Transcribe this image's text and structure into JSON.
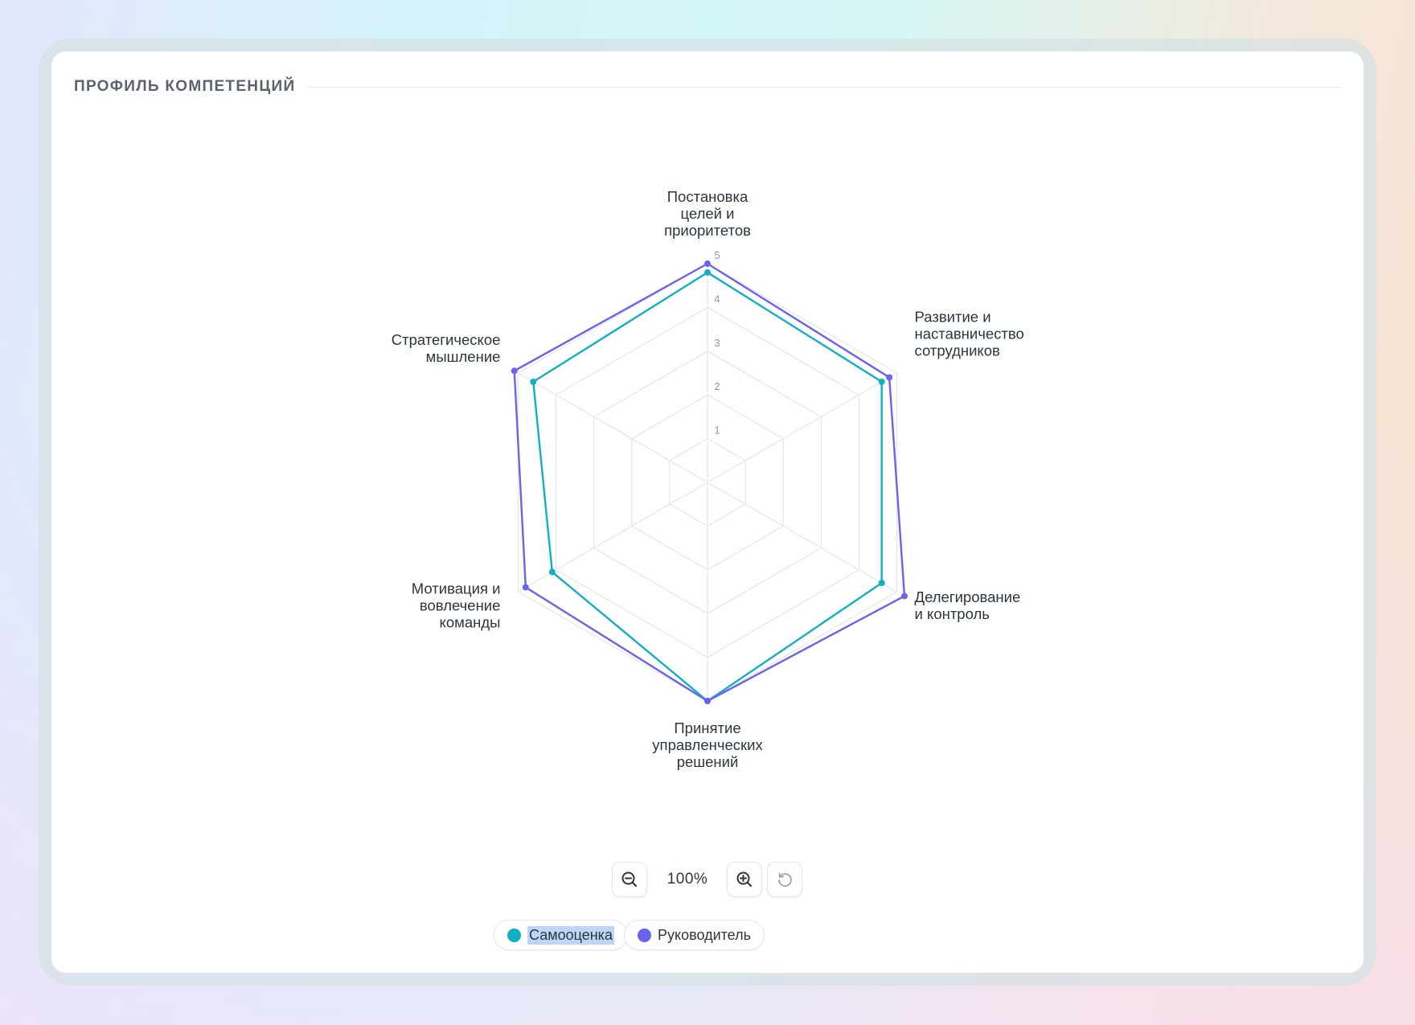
{
  "card": {
    "title": "ПРОФИЛЬ КОМПЕТЕНЦИЙ"
  },
  "chart_data": {
    "type": "radar",
    "axes": [
      [
        "Постановка",
        "целей и",
        "приоритетов"
      ],
      [
        "Развитие и",
        "наставничество",
        "сотрудников"
      ],
      [
        "Делегирование",
        "и контроль"
      ],
      [
        "Принятие",
        "управленческих",
        "решений"
      ],
      [
        "Мотивация и",
        "вовлечение",
        "команды"
      ],
      [
        "Стратегическое",
        "мышление"
      ]
    ],
    "range": [
      0,
      5
    ],
    "ticks": [
      1,
      2,
      3,
      4,
      5
    ],
    "grid": true,
    "legend_position": "bottom",
    "series": [
      {
        "name": "Самооценка",
        "color": "#12aec2",
        "values": [
          4.8,
          4.6,
          4.6,
          5.0,
          4.1,
          4.6
        ]
      },
      {
        "name": "Руководитель",
        "color": "#6a63ee",
        "values": [
          5.0,
          4.8,
          5.2,
          5.0,
          4.8,
          5.1
        ]
      }
    ]
  },
  "zoom": {
    "value": "100%"
  },
  "icons": {
    "zoom_out": "zoom-out-icon",
    "zoom_in": "zoom-in-icon",
    "reset": "reset-icon"
  }
}
